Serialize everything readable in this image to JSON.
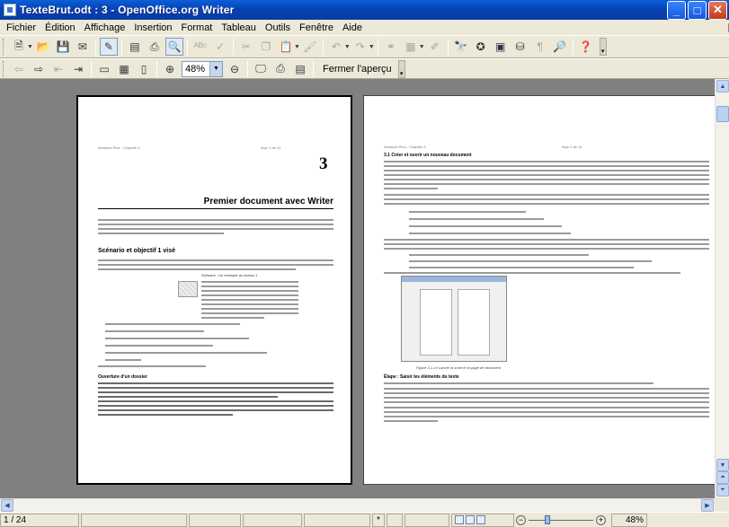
{
  "window": {
    "title": "TexteBrut.odt : 3 - OpenOffice.org Writer"
  },
  "menu": [
    "Fichier",
    "Édition",
    "Affichage",
    "Insertion",
    "Format",
    "Tableau",
    "Outils",
    "Fenêtre",
    "Aide"
  ],
  "toolbar2": {
    "zoom_value": "48%",
    "close_preview_label": "Fermer l'aperçu"
  },
  "page_left": {
    "header_left": "Advance Plus - Chapitre 3",
    "header_right": "Impr 1 de 14",
    "chapter_number": "3",
    "chapter_title": "Premier document avec Writer",
    "section_title": "Scénario et objectif 1 visé",
    "note_title": "Scénario : Un exemple au niveau 1",
    "sub_heading": "Ouverture d'un dossier"
  },
  "page_right": {
    "header_left": "Advance Plus - Chapitre 3",
    "header_right": "Impr 2 de 14",
    "heading": "3.1 Créer et ouvrir un nouveau document",
    "caption": "Figure 3-1 Le Lancer la zone et la page de document",
    "sub_heading": "Étape : Saisir les éléments du texte"
  },
  "statusbar": {
    "page_info": "1 / 24",
    "mode": "*",
    "zoom_percent": "48%"
  }
}
